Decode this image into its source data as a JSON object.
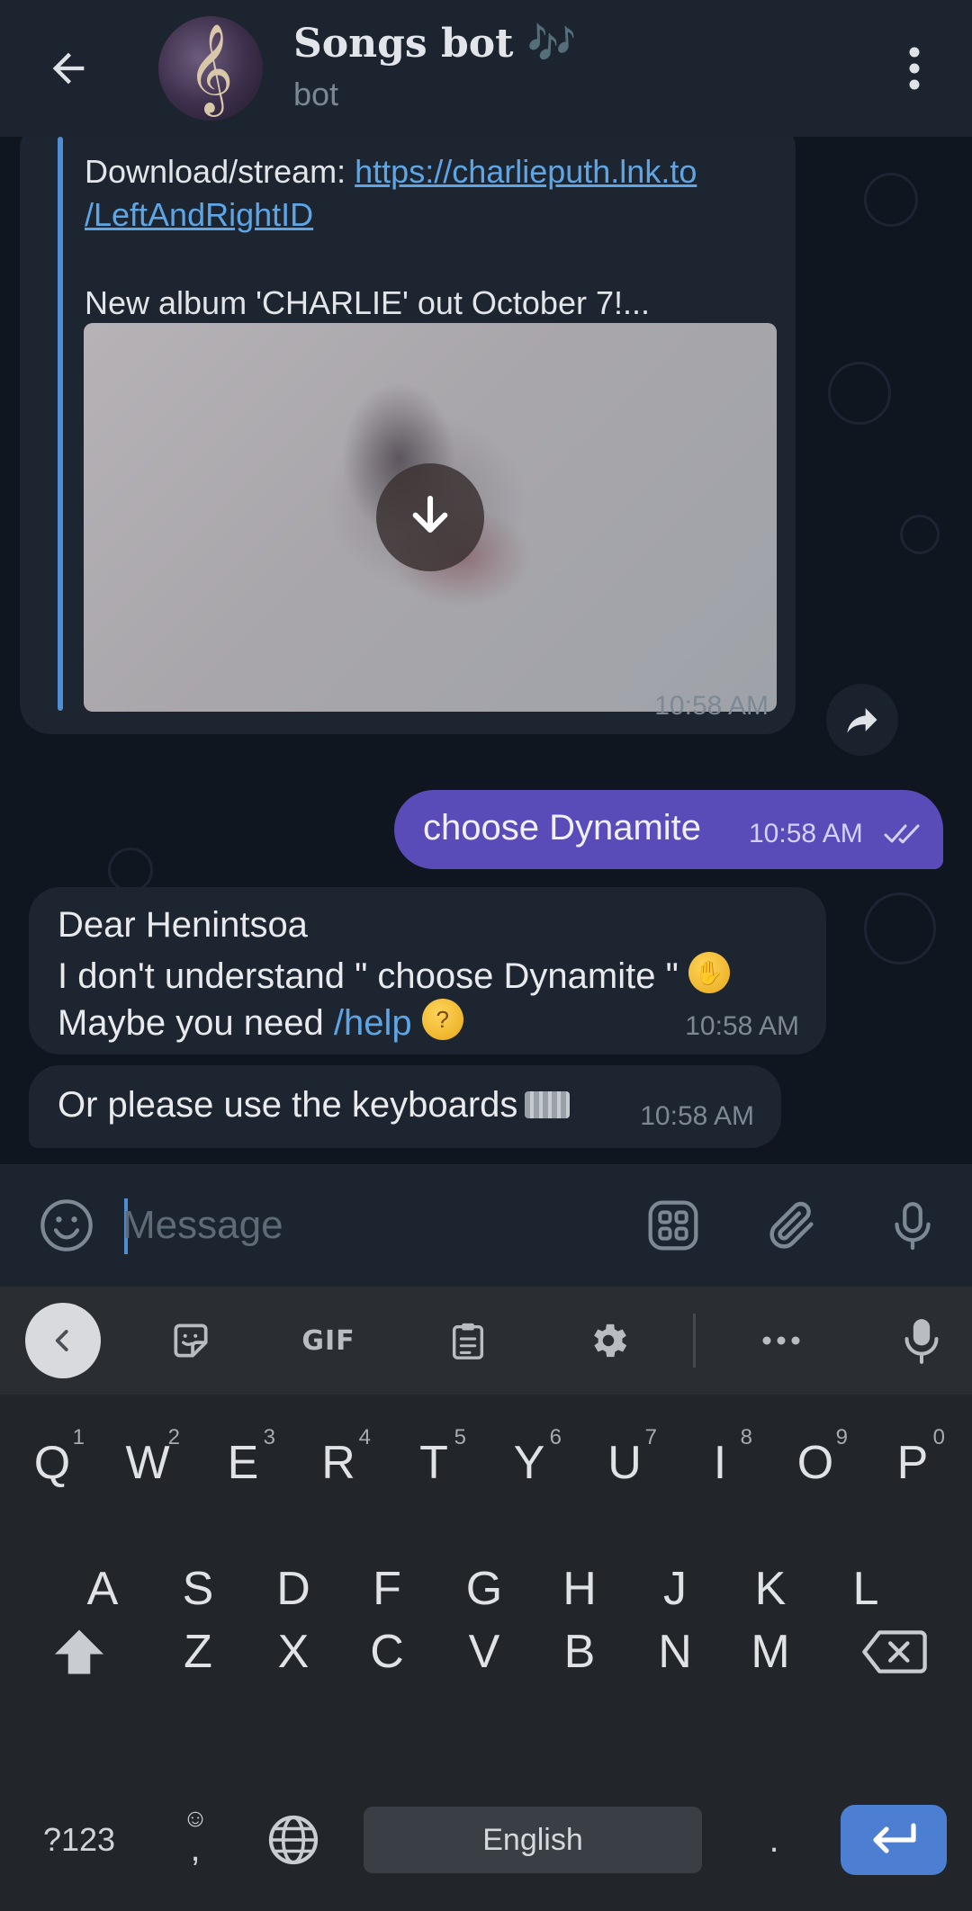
{
  "header": {
    "title": "Songs bot",
    "title_note": "🎶",
    "subtitle": "bot"
  },
  "messages": {
    "forwarded": {
      "line1_prefix": "Download/stream: ",
      "link_part1": "https://charlieputh.lnk.to",
      "link_part2": "/LeftAndRightID",
      "line3": "New album 'CHARLIE' out October 7!...",
      "time": "10:58 AM"
    },
    "outgoing": {
      "text": "choose Dynamite",
      "time": "10:58 AM"
    },
    "reply1": {
      "line1": "Dear Henintsoa",
      "line2": "I don't understand \" choose Dynamite \"",
      "line3_prefix": "Maybe you need ",
      "line3_command": "/help",
      "time": "10:58 AM"
    },
    "reply2": {
      "text": "Or please use the keyboards",
      "time": "10:58 AM"
    }
  },
  "input": {
    "placeholder": "Message"
  },
  "keyboard": {
    "toolbar": {
      "gif_label": "GIF"
    },
    "row1": [
      {
        "k": "Q",
        "s": "1"
      },
      {
        "k": "W",
        "s": "2"
      },
      {
        "k": "E",
        "s": "3"
      },
      {
        "k": "R",
        "s": "4"
      },
      {
        "k": "T",
        "s": "5"
      },
      {
        "k": "Y",
        "s": "6"
      },
      {
        "k": "U",
        "s": "7"
      },
      {
        "k": "I",
        "s": "8"
      },
      {
        "k": "O",
        "s": "9"
      },
      {
        "k": "P",
        "s": "0"
      }
    ],
    "row2": [
      "A",
      "S",
      "D",
      "F",
      "G",
      "H",
      "J",
      "K",
      "L"
    ],
    "row3": [
      "Z",
      "X",
      "C",
      "V",
      "B",
      "N",
      "M"
    ],
    "symbols_label": "?123",
    "comma_label": ",",
    "space_label": "English",
    "period_label": "."
  },
  "colors": {
    "accent": "#4f8ed2",
    "outgoing_bubble": "#5a4cb8",
    "incoming_bubble": "#1d2530",
    "enter_key": "#4c7fd2"
  }
}
